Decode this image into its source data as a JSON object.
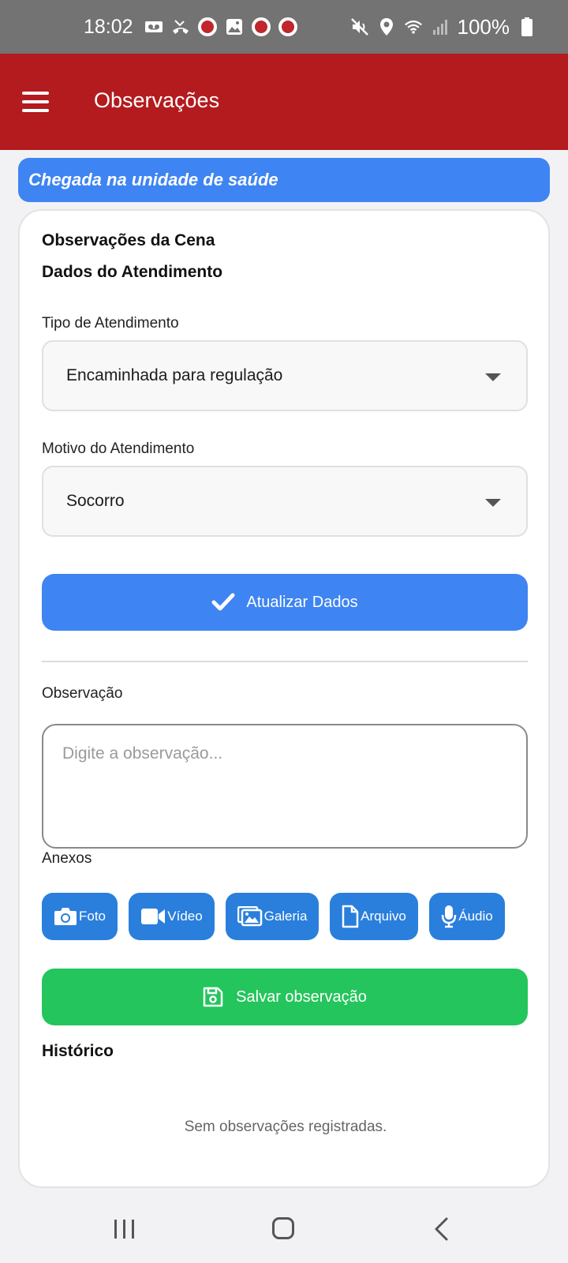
{
  "status_bar": {
    "time": "18:02",
    "battery": "100%",
    "left_icons": [
      "voicemail-icon",
      "missed-call-icon",
      "app-badge-icon",
      "image-icon",
      "app-badge-icon",
      "app-badge-icon"
    ],
    "right_icons": [
      "mute-icon",
      "location-icon",
      "wifi-icon",
      "signal-icon",
      "battery-icon"
    ]
  },
  "app_bar": {
    "title": "Observações",
    "menu_icon": "hamburger-menu-icon",
    "color": "#b31b1e"
  },
  "status_banner": {
    "text": "Chegada na unidade de saúde",
    "color": "#3e84f2"
  },
  "form": {
    "scene_heading": "Observações da Cena",
    "data_heading": "Dados do Atendimento",
    "tipo": {
      "label": "Tipo de Atendimento",
      "value": "Encaminhada para regulação"
    },
    "motivo": {
      "label": "Motivo do Atendimento",
      "value": "Socorro"
    },
    "update_button": {
      "label": "Atualizar Dados",
      "icon": "checkmark-icon"
    },
    "observacao": {
      "label": "Observação",
      "placeholder": "Digite a observação..."
    },
    "anexos": {
      "label": "Anexos",
      "buttons": [
        {
          "label": "Foto",
          "icon": "camera-icon"
        },
        {
          "label": "Vídeo",
          "icon": "video-icon"
        },
        {
          "label": "Galeria",
          "icon": "gallery-icon"
        },
        {
          "label": "Arquivo",
          "icon": "file-icon"
        },
        {
          "label": "Áudio",
          "icon": "microphone-icon"
        }
      ]
    },
    "save_button": {
      "label": "Salvar observação",
      "icon": "floppy-disk-icon"
    }
  },
  "historico": {
    "heading": "Histórico",
    "empty_message": "Sem observações registradas."
  },
  "colors": {
    "primary": "#3e84f2",
    "attach": "#2a7fdc",
    "success": "#24c55c"
  }
}
